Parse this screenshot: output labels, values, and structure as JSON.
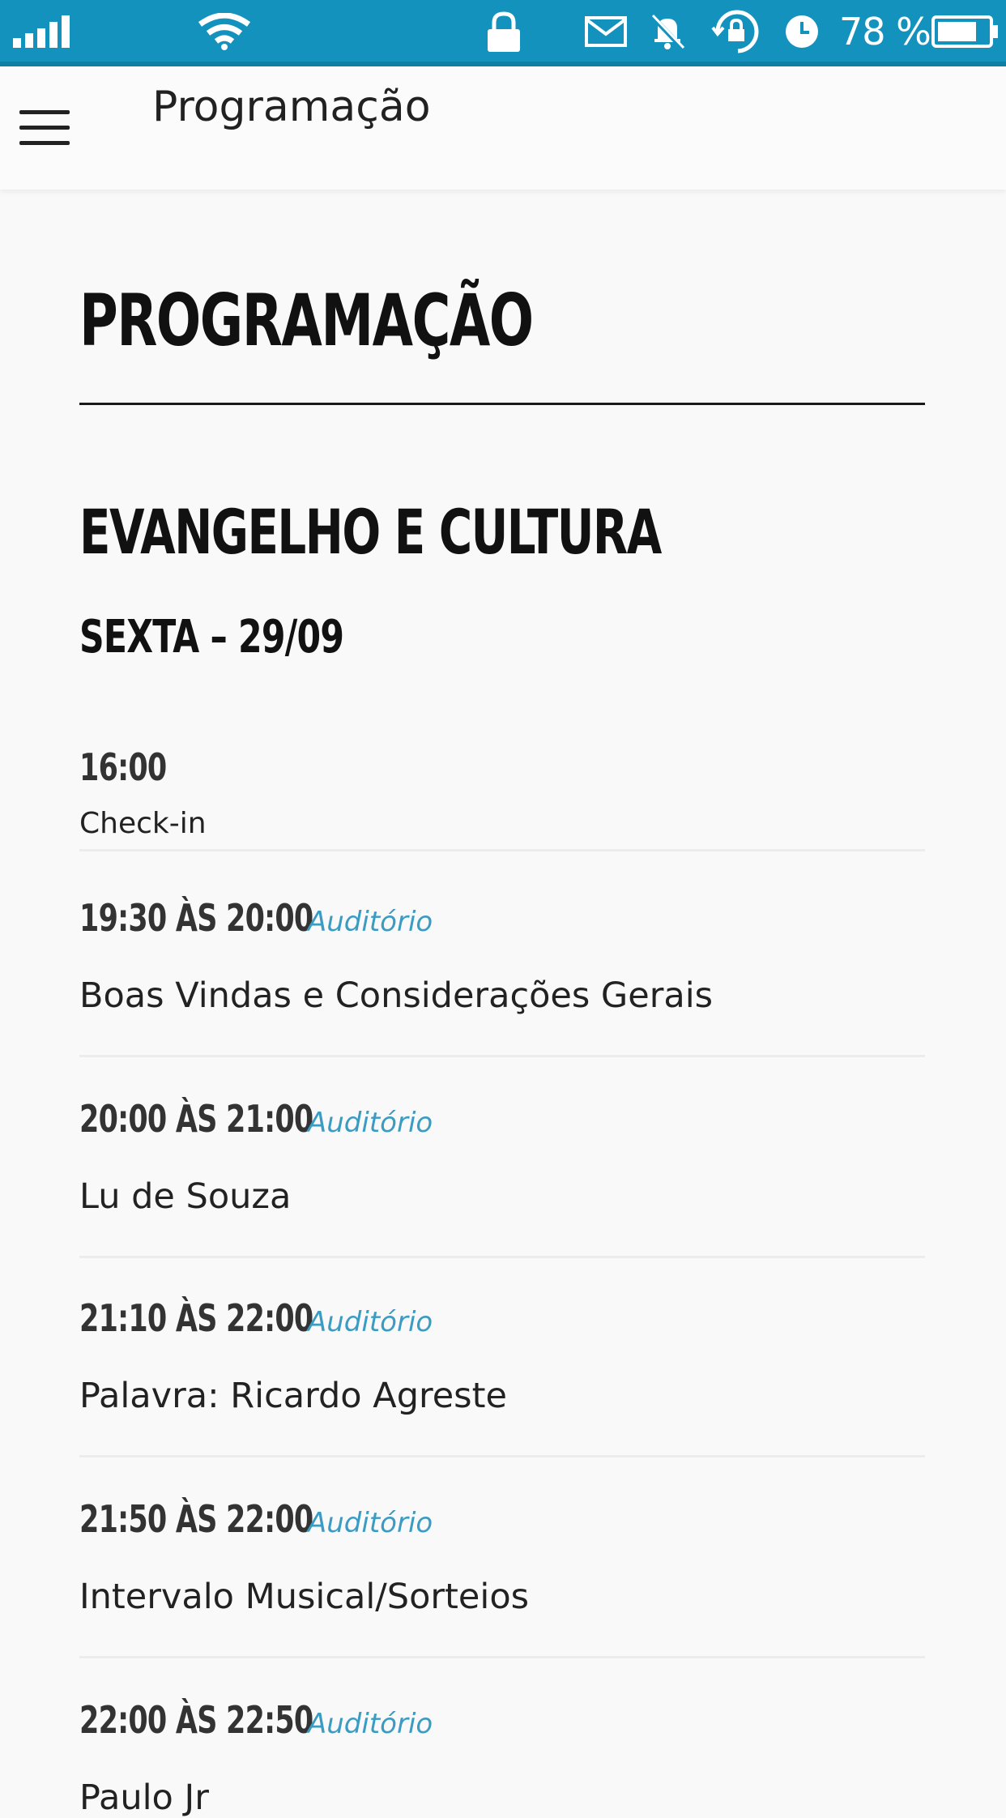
{
  "status_bar": {
    "battery_percent": "78 %",
    "battery_level": 0.78,
    "icons": [
      "signal-icon",
      "wifi-icon",
      "lock-icon",
      "mail-icon",
      "bell-off-icon",
      "rotation-lock-icon",
      "alarm-icon",
      "battery-icon"
    ],
    "background_color": "#1392bd"
  },
  "app_bar": {
    "title": "Programação",
    "menu_icon": "hamburger-menu-icon"
  },
  "content": {
    "heading": "PROGRAMAÇÃO",
    "section_title": "EVANGELHO E CULTURA",
    "day_title": "SEXTA – 29/09",
    "accent_color": "#3a9bc3",
    "events": [
      {
        "time": "16:00",
        "location": "",
        "description": "Check-in"
      },
      {
        "time": "19:30 ÀS 20:00",
        "location": "Auditório",
        "description": "Boas Vindas e Considerações Gerais"
      },
      {
        "time": "20:00 ÀS 21:00",
        "location": "Auditório",
        "description": "Lu de Souza"
      },
      {
        "time": "21:10 ÀS 22:00",
        "location": "Auditório",
        "description": "Palavra: Ricardo Agreste"
      },
      {
        "time": "21:50 ÀS 22:00",
        "location": "Auditório",
        "description": "Intervalo Musical/Sorteios"
      },
      {
        "time": "22:00 ÀS 22:50",
        "location": "Auditório",
        "description": "Paulo Jr"
      }
    ]
  }
}
